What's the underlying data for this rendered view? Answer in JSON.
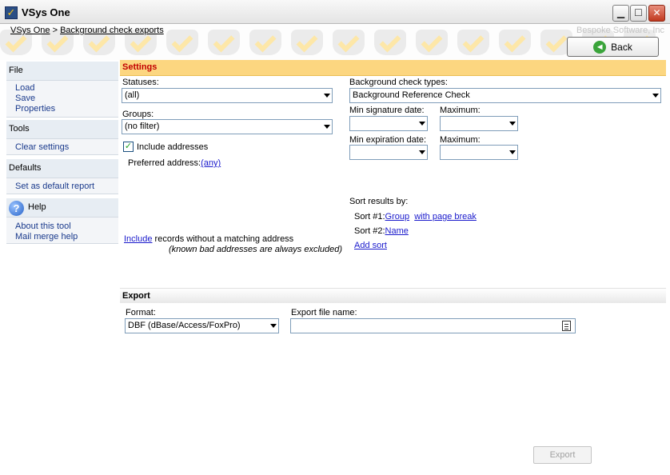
{
  "window": {
    "title": "VSys One",
    "minimize": "▁",
    "maximize": "☐",
    "close": "✕"
  },
  "header": {
    "breadcrumb_root": "VSys One",
    "breadcrumb_sep": ">",
    "breadcrumb_current": "Background check exports",
    "vendor": "Bespoke Software, Inc",
    "back_label": "Back"
  },
  "sidebar": {
    "file": {
      "title": "File",
      "items": [
        "Load",
        "Save",
        "Properties"
      ]
    },
    "tools": {
      "title": "Tools",
      "items": [
        "Clear settings"
      ]
    },
    "defaults": {
      "title": "Defaults",
      "items": [
        "Set as default report"
      ]
    },
    "help": {
      "title": "Help",
      "items": [
        "About this tool",
        "Mail merge help"
      ]
    }
  },
  "settings": {
    "title": "Settings",
    "statuses_label": "Statuses:",
    "statuses_value": "(all)",
    "groups_label": "Groups:",
    "groups_value": "(no filter)",
    "include_addresses_label": "Include addresses",
    "include_addresses_checked": true,
    "preferred_address_label": "Preferred address:",
    "preferred_address_value": "(any)",
    "include_link": "Include",
    "include_text": " records without a matching address",
    "include_note": "(known bad addresses are always excluded)",
    "check_types_label": "Background check types:",
    "check_types_value": "Background Reference Check",
    "min_signature_label": "Min signature date:",
    "maximum_label_1": "Maximum:",
    "min_expiration_label": "Min expiration date:",
    "maximum_label_2": "Maximum:",
    "sort_label": "Sort results by:",
    "sort1_label": "Sort #1:",
    "sort1_value": "Group",
    "sort1_extra": "with page break",
    "sort2_label": "Sort #2:",
    "sort2_value": "Name",
    "add_sort": "Add sort"
  },
  "export": {
    "title": "Export",
    "format_label": "Format:",
    "format_value": "DBF (dBase/Access/FoxPro)",
    "filename_label": "Export file name:",
    "filename_value": "",
    "export_button": "Export"
  },
  "colors": {
    "settings_header": "#fcd680",
    "settings_title": "#c20000",
    "link": "#1a1acc",
    "sidebar_link": "#1a3a8c"
  }
}
